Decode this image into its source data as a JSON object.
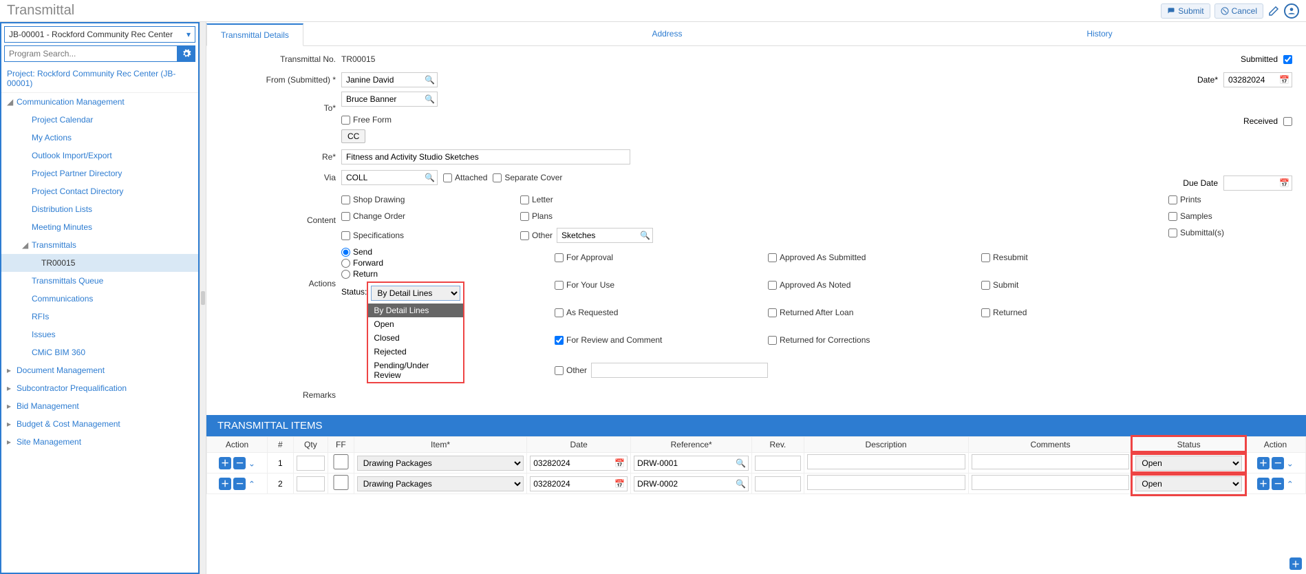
{
  "header": {
    "title": "Transmittal",
    "submit": "Submit",
    "cancel": "Cancel"
  },
  "sidebar": {
    "project_select": "JB-00001 - Rockford Community Rec Center",
    "search_placeholder": "Program Search...",
    "project_line_a": "Project: Rockford Community Rec Center",
    "project_line_b": "(JB-00001)",
    "sections": {
      "comm_mgmt": "Communication Management",
      "items": [
        "Project Calendar",
        "My Actions",
        "Outlook Import/Export",
        "Project Partner Directory",
        "Project Contact Directory",
        "Distribution Lists",
        "Meeting Minutes"
      ],
      "transmittals": "Transmittals",
      "tr_number": "TR00015",
      "more": [
        "Transmittals Queue",
        "Communications",
        "RFIs",
        "Issues",
        "CMiC BIM 360"
      ],
      "collapsed": [
        "Document Management",
        "Subcontractor Prequalification",
        "Bid Management",
        "Budget & Cost Management",
        "Site Management"
      ]
    }
  },
  "tabs": {
    "details": "Transmittal Details",
    "address": "Address",
    "history": "History"
  },
  "form": {
    "transmittal_no_label": "Transmittal No.",
    "transmittal_no": "TR00015",
    "from_label": "From (Submitted) *",
    "from": "Janine David",
    "to_label": "To*",
    "to": "Bruce Banner",
    "free_form": "Free Form",
    "cc": "CC",
    "re_label": "Re*",
    "re": "Fitness and Activity Studio Sketches",
    "via_label": "Via",
    "via": "COLL",
    "attached": "Attached",
    "separate_cover": "Separate Cover",
    "content_label": "Content",
    "content_opts": {
      "shop": "Shop Drawing",
      "letter": "Letter",
      "prints": "Prints",
      "change": "Change Order",
      "plans": "Plans",
      "samples": "Samples",
      "specs": "Specifications",
      "other": "Other",
      "other_val": "Sketches",
      "submittals": "Submittal(s)"
    },
    "actions_label": "Actions",
    "send": "Send",
    "forward": "Forward",
    "return": "Return",
    "status_label": "Status:",
    "status_sel": "By Detail Lines",
    "status_opts": [
      "By Detail Lines",
      "Open",
      "Closed",
      "Rejected",
      "Pending/Under Review"
    ],
    "action_cb": {
      "approval": "For Approval",
      "approved_sub": "Approved As Submitted",
      "resubmit": "Resubmit",
      "your_use": "For Your Use",
      "approved_noted": "Approved As Noted",
      "submit": "Submit",
      "as_requested": "As Requested",
      "returned_loan": "Returned After Loan",
      "returned": "Returned",
      "review": "For Review and Comment",
      "returned_corr": "Returned for Corrections",
      "other": "Other"
    },
    "remarks_label": "Remarks",
    "submitted_label": "Submitted",
    "date_label": "Date*",
    "date": "03282024",
    "received_label": "Received",
    "due_label": "Due Date"
  },
  "items": {
    "title": "TRANSMITTAL ITEMS",
    "cols": {
      "action": "Action",
      "num": "#",
      "qty": "Qty",
      "ff": "FF",
      "item": "Item*",
      "date": "Date",
      "ref": "Reference*",
      "rev": "Rev.",
      "desc": "Description",
      "comments": "Comments",
      "status": "Status"
    },
    "rows": [
      {
        "num": "1",
        "item": "Drawing Packages",
        "date": "03282024",
        "ref": "DRW-0001",
        "status": "Open"
      },
      {
        "num": "2",
        "item": "Drawing Packages",
        "date": "03282024",
        "ref": "DRW-0002",
        "status": "Open"
      }
    ]
  }
}
